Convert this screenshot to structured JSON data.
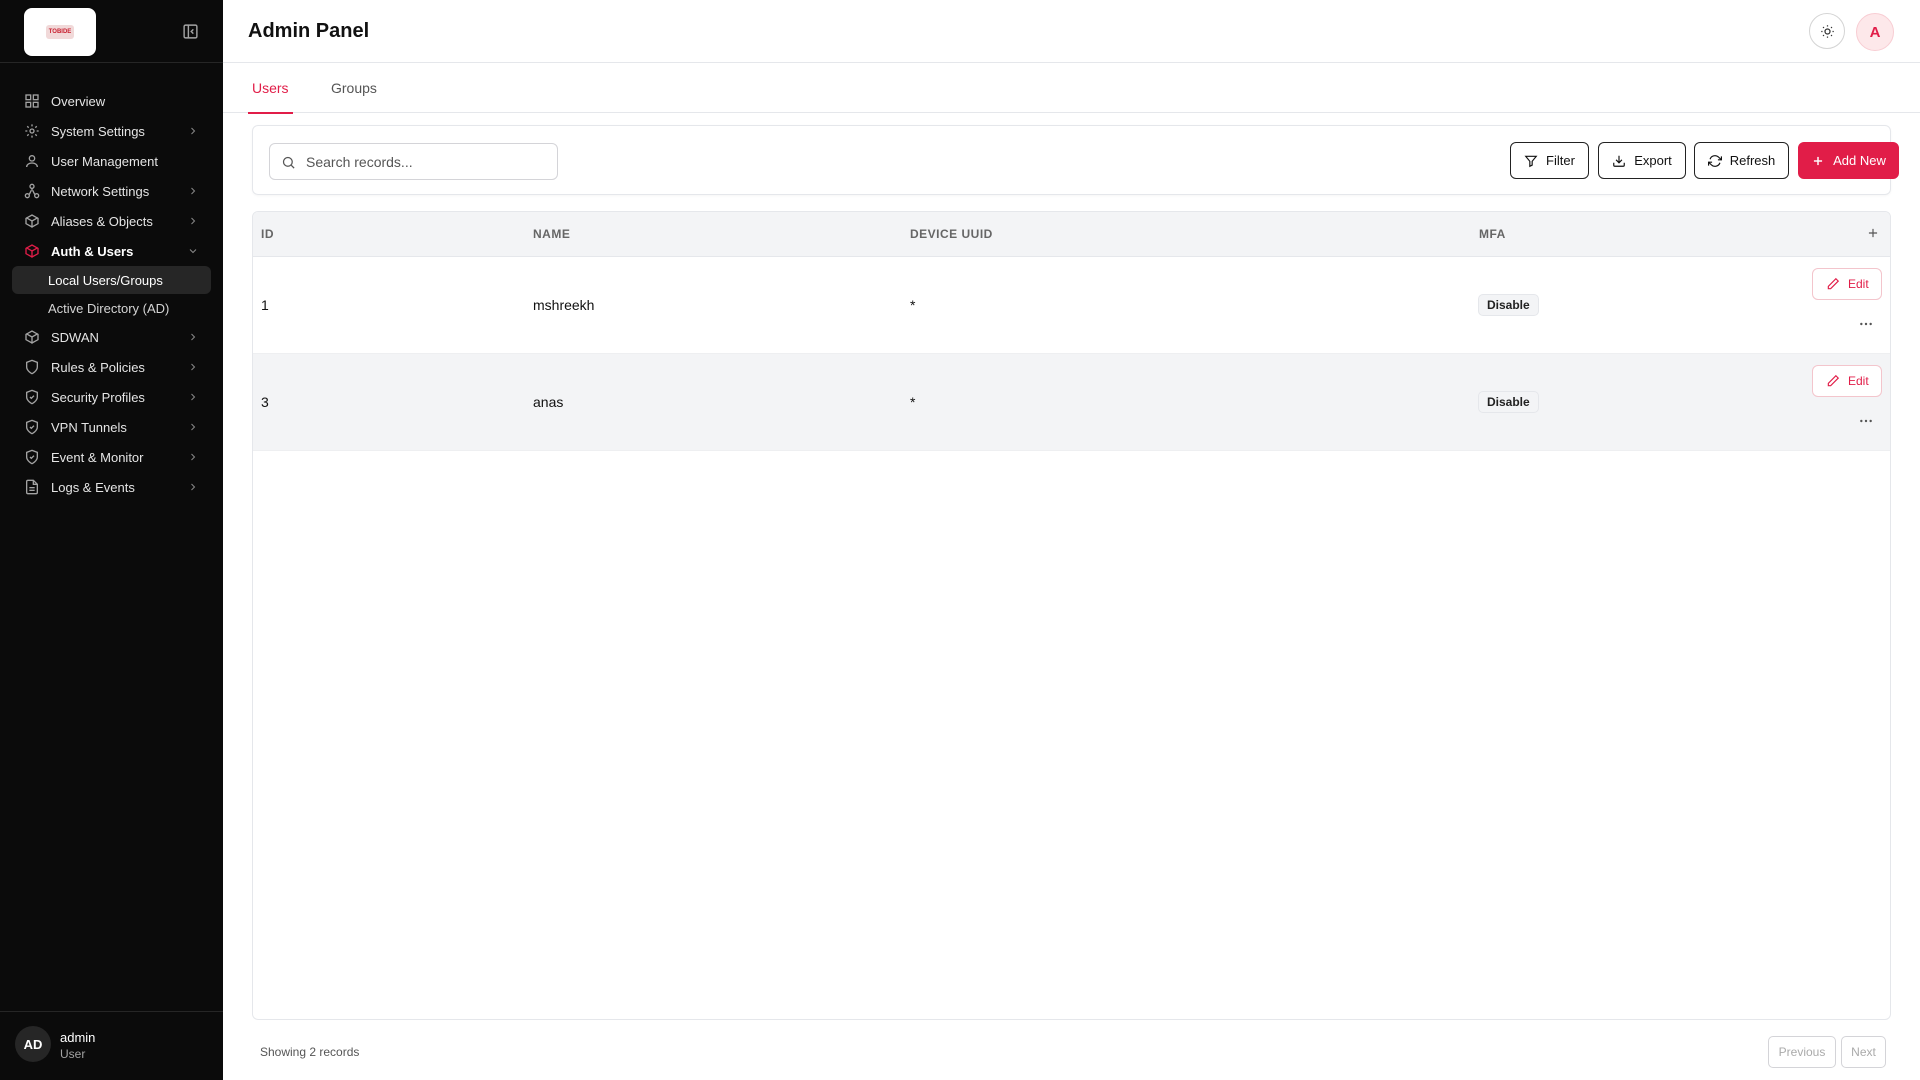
{
  "sidebar": {
    "logo_text": "TOBIDE",
    "items": [
      {
        "label": "Overview"
      },
      {
        "label": "System Settings"
      },
      {
        "label": "User Management"
      },
      {
        "label": "Network Settings"
      },
      {
        "label": "Aliases & Objects"
      },
      {
        "label": "Auth & Users"
      },
      {
        "label": "SDWAN"
      },
      {
        "label": "Rules & Policies"
      },
      {
        "label": "Security Profiles"
      },
      {
        "label": "VPN Tunnels"
      },
      {
        "label": "Event & Monitor"
      },
      {
        "label": "Logs & Events"
      }
    ],
    "subitems": [
      {
        "label": "Local Users/Groups"
      },
      {
        "label": "Active Directory (AD)"
      }
    ],
    "user": {
      "initials": "AD",
      "name": "admin",
      "role": "User"
    }
  },
  "header": {
    "title": "Admin Panel",
    "profile_initial": "A"
  },
  "tabs": [
    {
      "label": "Users"
    },
    {
      "label": "Groups"
    }
  ],
  "toolbar": {
    "search_placeholder": "Search records...",
    "filter_label": "Filter",
    "export_label": "Export",
    "refresh_label": "Refresh",
    "add_label": "Add New"
  },
  "table": {
    "columns": [
      "ID",
      "NAME",
      "DEVICE UUID",
      "MFA"
    ],
    "rows": [
      {
        "id": "1",
        "name": "mshreekh",
        "device_uuid": "*",
        "mfa": "Disable",
        "edit_label": "Edit"
      },
      {
        "id": "3",
        "name": "anas",
        "device_uuid": "*",
        "mfa": "Disable",
        "edit_label": "Edit"
      }
    ]
  },
  "footer": {
    "records_text": "Showing 2 records",
    "previous_label": "Previous",
    "next_label": "Next"
  },
  "colors": {
    "accent": "#e11d48",
    "sidebar_bg": "#0b0b0b"
  }
}
